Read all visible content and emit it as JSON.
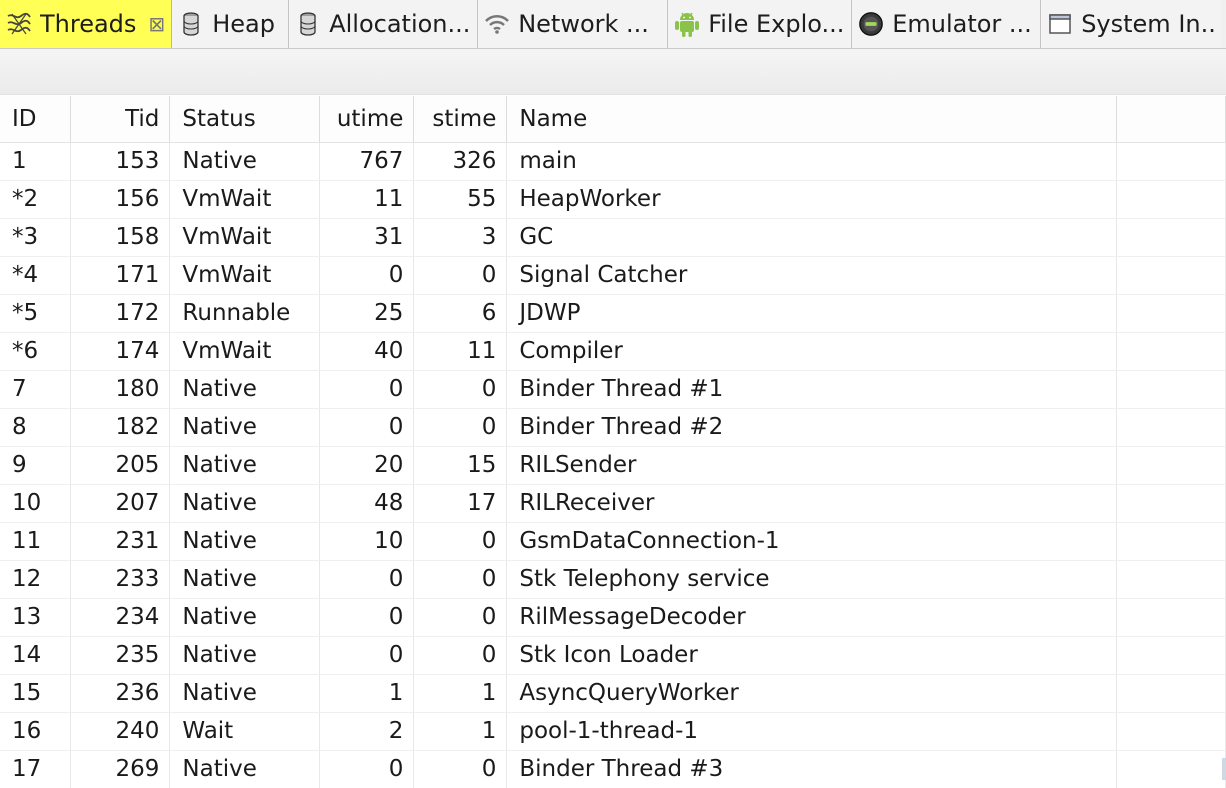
{
  "tabs": [
    {
      "label": "Threads",
      "icon": "threads-icon",
      "active": true,
      "closable": true
    },
    {
      "label": "Heap",
      "icon": "heap-cylinder-icon"
    },
    {
      "label": "Allocation...",
      "icon": "allocation-cylinder-icon"
    },
    {
      "label": "Network ...",
      "icon": "network-wifi-icon"
    },
    {
      "label": "File Explo...",
      "icon": "android-icon"
    },
    {
      "label": "Emulator ...",
      "icon": "emulator-icon"
    },
    {
      "label": "System In...",
      "icon": "window-icon"
    }
  ],
  "close_glyph": "⊠",
  "table": {
    "columns": [
      "ID",
      "Tid",
      "Status",
      "utime",
      "stime",
      "Name"
    ],
    "rows": [
      {
        "id": "1",
        "tid": "153",
        "status": "Native",
        "utime": "767",
        "stime": "326",
        "name": "main"
      },
      {
        "id": "*2",
        "tid": "156",
        "status": "VmWait",
        "utime": "11",
        "stime": "55",
        "name": "HeapWorker"
      },
      {
        "id": "*3",
        "tid": "158",
        "status": "VmWait",
        "utime": "31",
        "stime": "3",
        "name": "GC"
      },
      {
        "id": "*4",
        "tid": "171",
        "status": "VmWait",
        "utime": "0",
        "stime": "0",
        "name": "Signal Catcher"
      },
      {
        "id": "*5",
        "tid": "172",
        "status": "Runnable",
        "utime": "25",
        "stime": "6",
        "name": "JDWP"
      },
      {
        "id": "*6",
        "tid": "174",
        "status": "VmWait",
        "utime": "40",
        "stime": "11",
        "name": "Compiler"
      },
      {
        "id": "7",
        "tid": "180",
        "status": "Native",
        "utime": "0",
        "stime": "0",
        "name": "Binder Thread #1"
      },
      {
        "id": "8",
        "tid": "182",
        "status": "Native",
        "utime": "0",
        "stime": "0",
        "name": "Binder Thread #2"
      },
      {
        "id": "9",
        "tid": "205",
        "status": "Native",
        "utime": "20",
        "stime": "15",
        "name": "RILSender"
      },
      {
        "id": "10",
        "tid": "207",
        "status": "Native",
        "utime": "48",
        "stime": "17",
        "name": "RILReceiver"
      },
      {
        "id": "11",
        "tid": "231",
        "status": "Native",
        "utime": "10",
        "stime": "0",
        "name": "GsmDataConnection-1"
      },
      {
        "id": "12",
        "tid": "233",
        "status": "Native",
        "utime": "0",
        "stime": "0",
        "name": "Stk Telephony service"
      },
      {
        "id": "13",
        "tid": "234",
        "status": "Native",
        "utime": "0",
        "stime": "0",
        "name": "RilMessageDecoder"
      },
      {
        "id": "14",
        "tid": "235",
        "status": "Native",
        "utime": "0",
        "stime": "0",
        "name": "Stk Icon Loader"
      },
      {
        "id": "15",
        "tid": "236",
        "status": "Native",
        "utime": "1",
        "stime": "1",
        "name": "AsyncQueryWorker"
      },
      {
        "id": "16",
        "tid": "240",
        "status": "Wait",
        "utime": "2",
        "stime": "1",
        "name": "pool-1-thread-1"
      },
      {
        "id": "17",
        "tid": "269",
        "status": "Native",
        "utime": "0",
        "stime": "0",
        "name": "Binder Thread #3"
      }
    ]
  },
  "colors": {
    "active_tab": "#ffff55",
    "tab_bg": "#f3f3f3",
    "android_green": "#8bc34a"
  }
}
